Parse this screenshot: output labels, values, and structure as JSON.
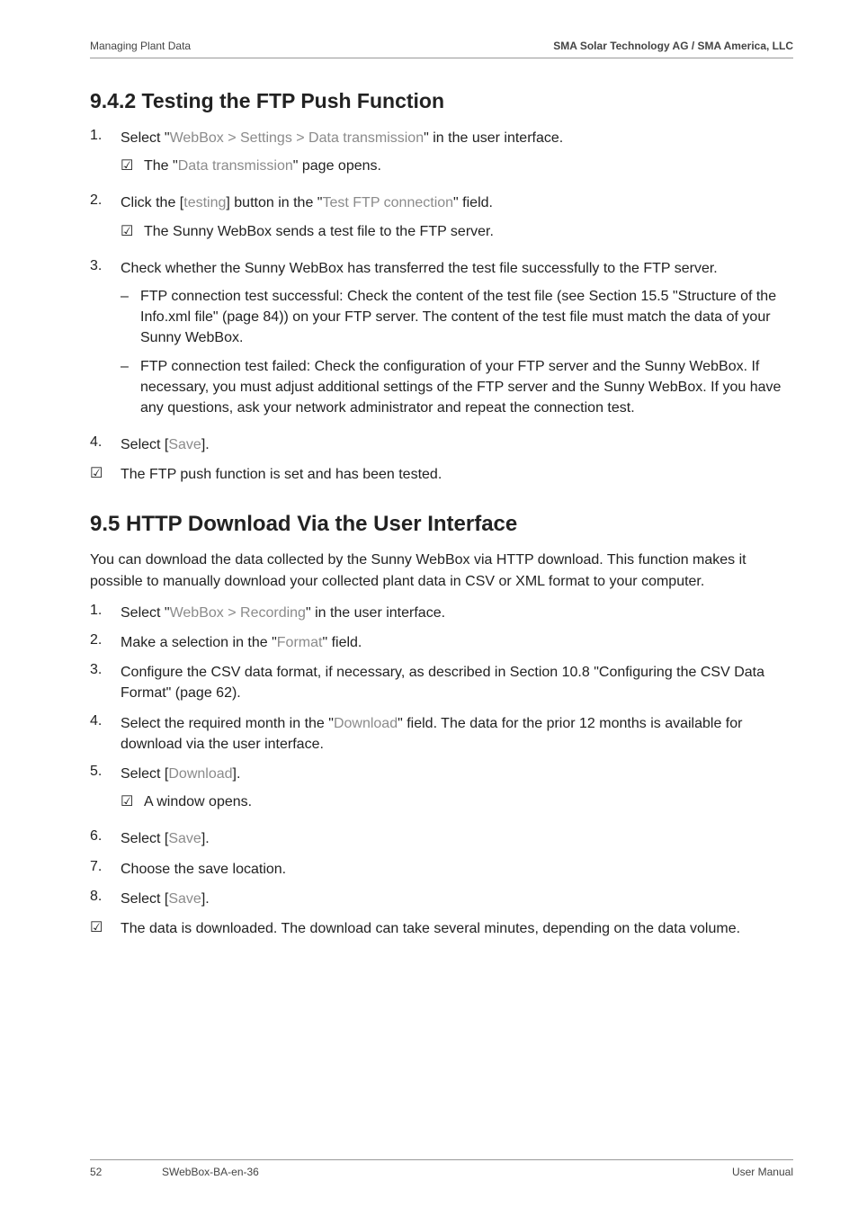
{
  "header": {
    "left": "Managing Plant Data",
    "right": "SMA Solar Technology AG / SMA America, LLC"
  },
  "section942": {
    "title": "9.4.2  Testing the FTP Push Function",
    "items": [
      {
        "num": "1.",
        "pre": "Select \"",
        "gray": "WebBox > Settings > Data transmission",
        "post": "\" in the user interface.",
        "sub_check": {
          "pre": "The \"",
          "gray": "Data transmission",
          "post": "\" page opens."
        }
      },
      {
        "num": "2.",
        "pre": "Click the [",
        "gray": "testing",
        "mid": "] button in the \"",
        "gray2": "Test FTP connection",
        "post": "\" field.",
        "sub_check_plain": "The Sunny WebBox sends a test file to the FTP server."
      },
      {
        "num": "3.",
        "plain": "Check whether the Sunny WebBox has transferred the test file successfully to the FTP server.",
        "dashes": [
          "FTP connection test successful: Check the content of the test file (see Section 15.5 \"Structure of the Info.xml file\" (page 84)) on your FTP server. The content of the test file must match the data of your Sunny WebBox.",
          "FTP connection test failed: Check the configuration of your FTP server and the Sunny WebBox. If necessary, you must adjust additional settings of the FTP server and the Sunny WebBox. If you have any questions, ask your network administrator and repeat the connection test."
        ]
      },
      {
        "num": "4.",
        "pre": "Select [",
        "gray": "Save",
        "post": "]."
      }
    ],
    "final_check": "The FTP push function is set and has been tested."
  },
  "section95": {
    "title": "9.5  HTTP Download Via the User Interface",
    "intro": "You can download the data collected by the Sunny WebBox via HTTP download. This function makes it possible to manually download your collected plant data in CSV or XML format to your computer.",
    "items": [
      {
        "num": "1.",
        "pre": "Select \"",
        "gray": "WebBox > Recording",
        "post": "\" in the user interface."
      },
      {
        "num": "2.",
        "pre": "Make a selection in the \"",
        "gray": "Format",
        "post": "\" field."
      },
      {
        "num": "3.",
        "plain": "Configure the CSV data format, if necessary, as described in Section 10.8 \"Configuring the CSV Data Format\" (page 62)."
      },
      {
        "num": "4.",
        "pre": "Select the required month in the \"",
        "gray": "Download",
        "post": "\" field. The data for the prior 12 months is available for download via the user interface."
      },
      {
        "num": "5.",
        "pre": "Select [",
        "gray": "Download",
        "post": "].",
        "sub_check_plain": "A window opens."
      },
      {
        "num": "6.",
        "pre": "Select [",
        "gray": "Save",
        "post": "]."
      },
      {
        "num": "7.",
        "plain": "Choose the save location."
      },
      {
        "num": "8.",
        "pre": "Select [",
        "gray": "Save",
        "post": "]."
      }
    ],
    "final_check": "The data is downloaded. The download can take several minutes, depending on the data volume."
  },
  "footer": {
    "left": "52",
    "mid": "SWebBox-BA-en-36",
    "right": "User Manual"
  },
  "glyph": {
    "check": "☑",
    "dash": "–"
  }
}
